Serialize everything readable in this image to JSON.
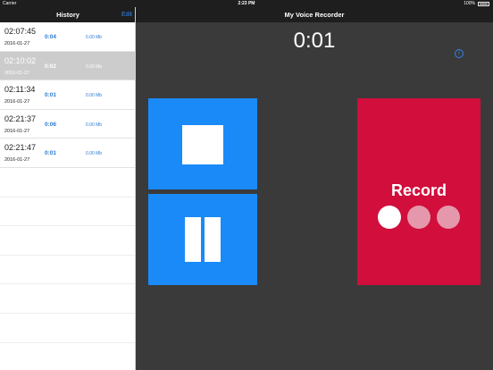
{
  "status_bar": {
    "carrier": "Carrier",
    "time": "2:23 PM",
    "battery": "100%"
  },
  "sidebar": {
    "title": "History",
    "edit_label": "Edit",
    "recordings": [
      {
        "time": "02:07:45",
        "date": "2016-01-27",
        "duration": "0:04",
        "size": "0.00 Mb",
        "selected": false
      },
      {
        "time": "02:10:02",
        "date": "2016-01-27",
        "duration": "0:02",
        "size": "0.00 Mb",
        "selected": true
      },
      {
        "time": "02:11:34",
        "date": "2016-01-27",
        "duration": "0:01",
        "size": "0.00 Mb",
        "selected": false
      },
      {
        "time": "02:21:37",
        "date": "2016-01-27",
        "duration": "0:06",
        "size": "0.00 Mb",
        "selected": false
      },
      {
        "time": "02:21:47",
        "date": "2016-01-27",
        "duration": "0:01",
        "size": "0.00 Mb",
        "selected": false
      }
    ]
  },
  "main": {
    "title": "My Voice Recorder",
    "timer": "0:01",
    "info_icon": "info-icon",
    "stop_icon": "stop-icon",
    "pause_icon": "pause-icon",
    "record_label": "Record",
    "record_level_dots_active": 1,
    "record_level_dots_total": 3
  },
  "colors": {
    "accent_blue": "#1a8af8",
    "record_red": "#d10e3c",
    "selected_row": "#cccccc",
    "background_dark": "#3a3a3a"
  }
}
